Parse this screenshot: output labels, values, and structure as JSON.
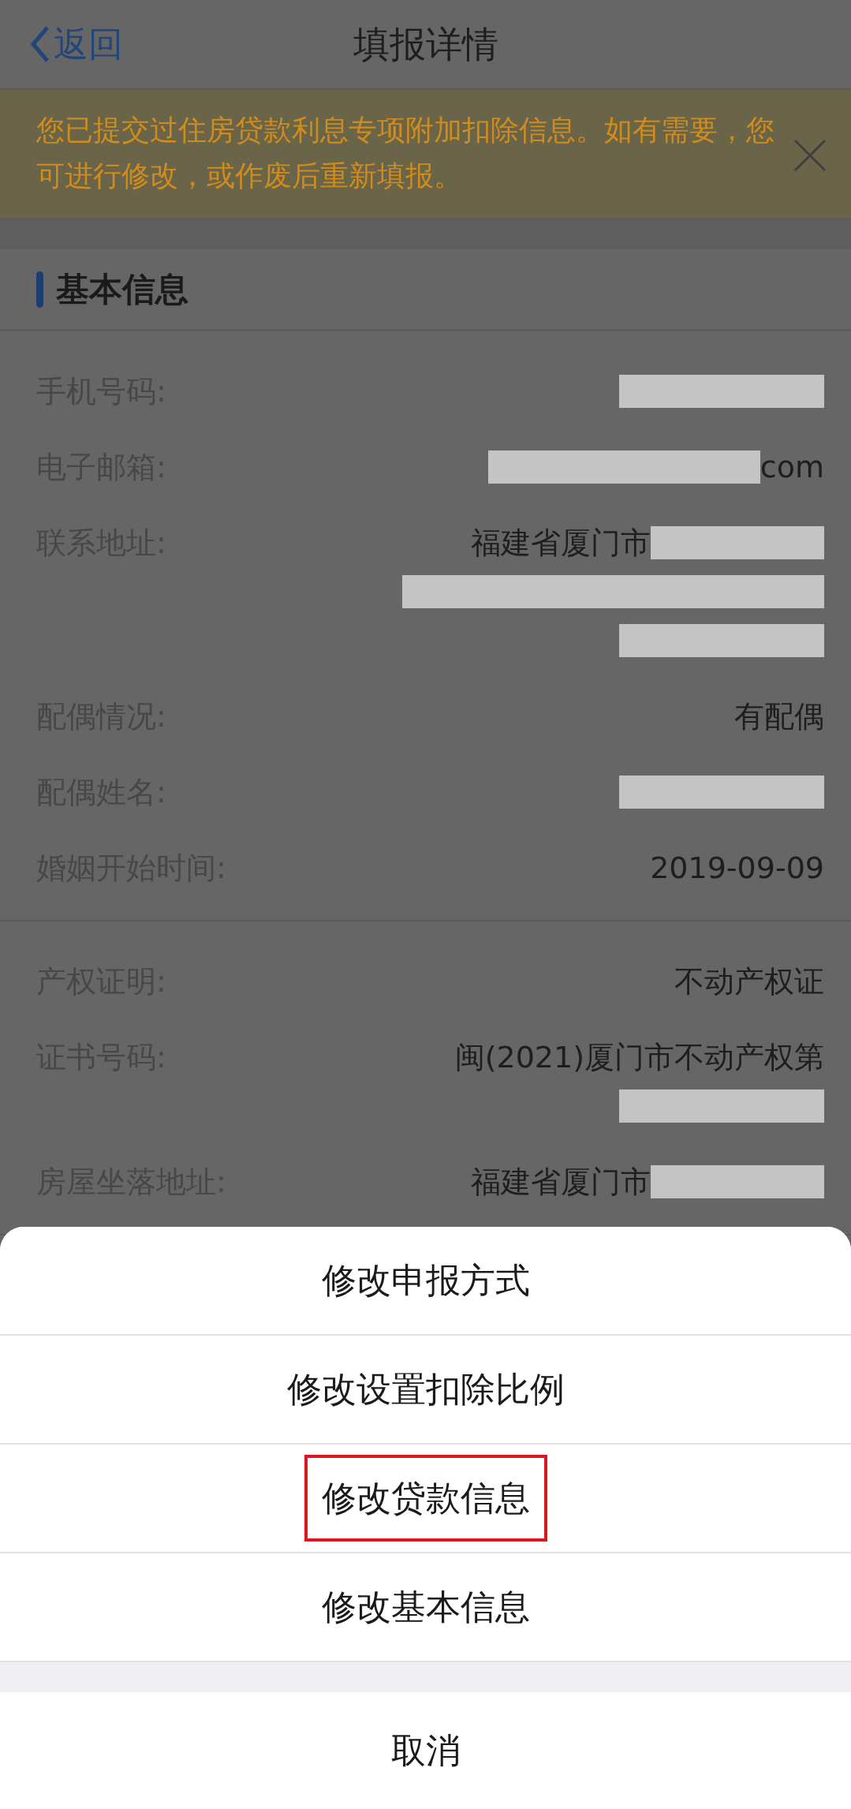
{
  "nav": {
    "back": "返回",
    "title": "填报详情"
  },
  "notice": {
    "text": "您已提交过住房贷款利息专项附加扣除信息。如有需要，您可进行修改，或作废后重新填报。"
  },
  "section": {
    "title": "基本信息"
  },
  "groups": [
    {
      "rows": [
        {
          "label": "手机号码:",
          "lines": [
            [
              {
                "kind": "redacted"
              }
            ]
          ]
        },
        {
          "label": "电子邮箱:",
          "lines": [
            [
              {
                "kind": "redacted"
              },
              {
                "kind": "text",
                "text": "com"
              }
            ]
          ]
        },
        {
          "label": "联系地址:",
          "lines": [
            [
              {
                "kind": "text",
                "text": "福建省厦门市"
              },
              {
                "kind": "redacted"
              }
            ],
            [
              {
                "kind": "redacted"
              }
            ],
            [
              {
                "kind": "redacted"
              }
            ]
          ]
        },
        {
          "label": "配偶情况:",
          "lines": [
            [
              {
                "kind": "text",
                "text": "有配偶"
              }
            ]
          ]
        },
        {
          "label": "配偶姓名:",
          "lines": [
            [
              {
                "kind": "redacted"
              }
            ]
          ]
        },
        {
          "label": "婚姻开始时间:",
          "lines": [
            [
              {
                "kind": "text",
                "text": "2019-09-09"
              }
            ]
          ]
        }
      ]
    },
    {
      "rows": [
        {
          "label": "产权证明:",
          "lines": [
            [
              {
                "kind": "text",
                "text": "不动产权证"
              }
            ]
          ]
        },
        {
          "label": "证书号码:",
          "lines": [
            [
              {
                "kind": "text",
                "text": "闽(2021)厦门市不动产权第"
              }
            ],
            [
              {
                "kind": "redacted"
              }
            ]
          ]
        },
        {
          "label": "房屋坐落地址:",
          "lines": [
            [
              {
                "kind": "text",
                "text": "福建省厦门市"
              },
              {
                "kind": "redacted"
              }
            ]
          ]
        }
      ]
    }
  ],
  "action_sheet": {
    "items": [
      {
        "label": "修改申报方式",
        "highlighted": false
      },
      {
        "label": "修改设置扣除比例",
        "highlighted": false
      },
      {
        "label": "修改贷款信息",
        "highlighted": true
      },
      {
        "label": "修改基本信息",
        "highlighted": false
      }
    ],
    "cancel": "取消"
  }
}
